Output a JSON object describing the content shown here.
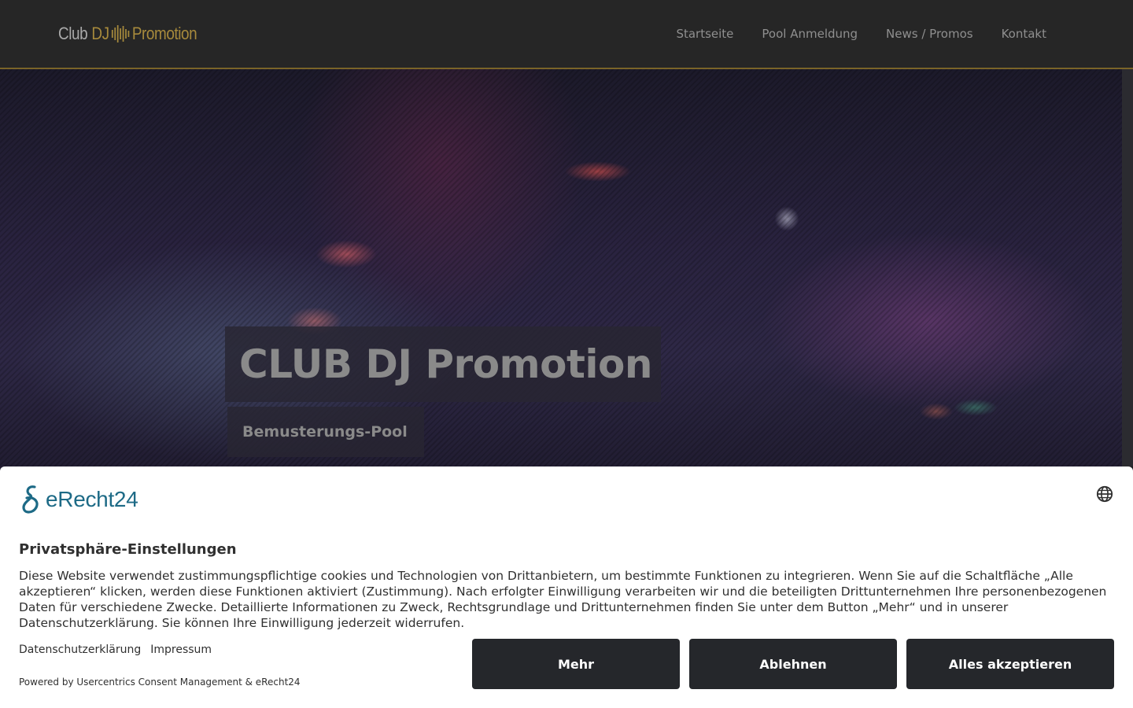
{
  "header": {
    "logo": {
      "word1": "Club",
      "word2": "DJ",
      "word3": "Promotion"
    },
    "nav": [
      {
        "label": "Startseite"
      },
      {
        "label": "Pool Anmeldung"
      },
      {
        "label": "News / Promos"
      },
      {
        "label": "Kontakt"
      }
    ]
  },
  "hero": {
    "title": "CLUB DJ Promotion",
    "subtitle": "Bemusterungs-Pool"
  },
  "consent": {
    "brand": "eRecht24",
    "globe_icon": "globe-icon",
    "title": "Privatsphäre-Einstellungen",
    "text": "Diese Website verwendet zustimmungspflichtige cookies und Technologien von Drittanbietern, um bestimmte Funktionen zu integrieren. Wenn Sie auf die Schaltfläche „Alle akzeptieren“ klicken, werden diese Funktionen aktiviert (Zustimmung). Nach erfolgter Einwilligung verarbeiten wir und die beteiligten Drittunternehmen Ihre personenbezogenen Daten für verschiedene Zwecke. Detaillierte Informationen zu Zweck, Rechtsgrundlage und Drittunternehmen finden Sie unter dem Button „Mehr“ und in unserer Datenschutzerklärung. Sie können Ihre Einwilligung jederzeit widerrufen.",
    "links": {
      "privacy": "Datenschutzerklärung",
      "imprint": "Impressum"
    },
    "powered_by": "Powered by Usercentrics Consent Management & eRecht24",
    "buttons": {
      "more": "Mehr",
      "decline": "Ablehnen",
      "accept_all": "Alles akzeptieren"
    }
  },
  "colors": {
    "header_bg": "#262626",
    "accent_gold": "#a78a3c",
    "button_bg": "#25272b",
    "brand_teal": "#1d6a86"
  }
}
